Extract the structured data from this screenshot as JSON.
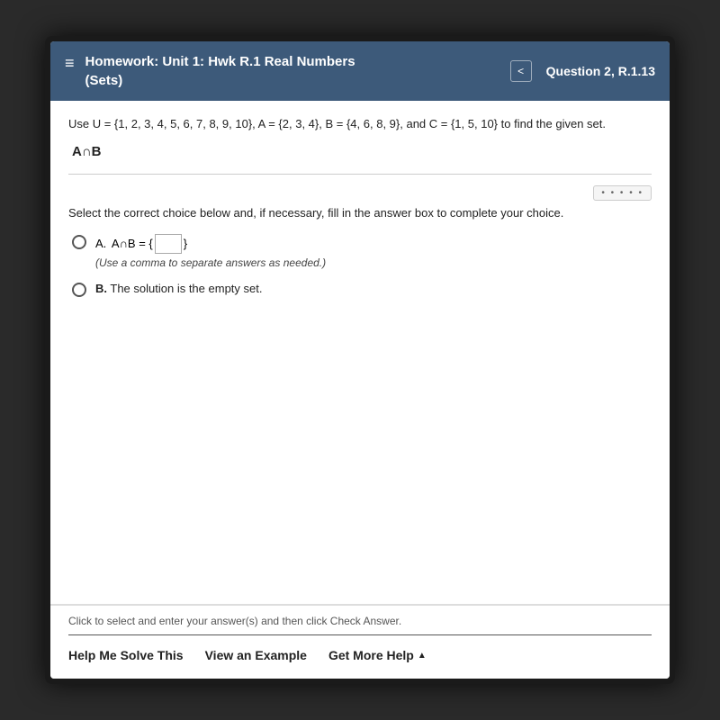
{
  "header": {
    "menu_icon": "≡",
    "title_line1": "Homework: Unit 1: Hwk R.1 Real Numbers",
    "title_line2": "(Sets)",
    "nav_arrow": "<",
    "question_prefix": "Question 2,",
    "question_id": "R.1.13"
  },
  "problem": {
    "statement": "Use U = {1, 2, 3, 4, 5, 6, 7, 8, 9, 10}, A = {2, 3, 4}, B = {4, 6, 8, 9}, and C = {1, 5, 10} to find the given set.",
    "expression": "A∩B",
    "dots_label": "• • • • •"
  },
  "instructions": {
    "text": "Select the correct choice below and, if necessary, fill in the answer box to complete your choice."
  },
  "choices": [
    {
      "id": "A",
      "label": "A.",
      "answer_prefix": "A∩B = {",
      "answer_suffix": "}",
      "has_input": true,
      "sub_text": "(Use a comma to separate answers as needed.)"
    },
    {
      "id": "B",
      "label": "B.",
      "text": "The solution is the empty set.",
      "has_input": false,
      "sub_text": ""
    }
  ],
  "footer": {
    "note": "Click to select and enter your answer(s) and then click Check Answer.",
    "buttons": {
      "help_me_solve": "Help Me Solve This",
      "view_example": "View an Example",
      "get_more_help": "Get More Help",
      "arrow": "▲"
    }
  }
}
